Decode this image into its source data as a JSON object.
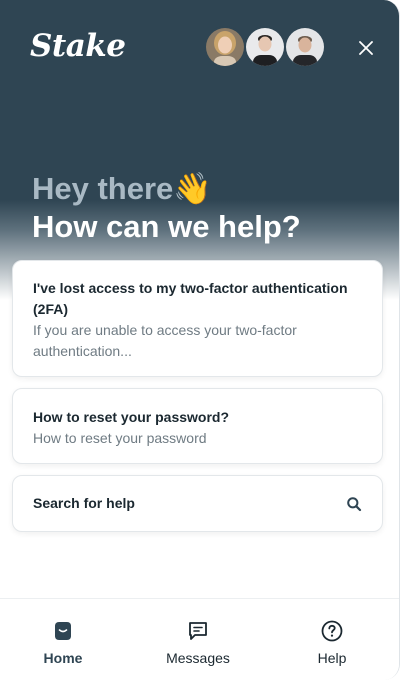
{
  "header": {
    "logo_text": "Stake",
    "avatars": [
      "team-member-1",
      "team-member-2",
      "team-member-3"
    ],
    "close_icon": "close-icon"
  },
  "hero": {
    "greeting": "Hey there",
    "greeting_emoji": "👋",
    "headline": "How can we help?"
  },
  "cards": [
    {
      "title": "I've lost access to my two-factor authentication (2FA)",
      "description": "If you are unable to access your two-factor authentication..."
    },
    {
      "title": "How to reset your password?",
      "description": "How to reset your password"
    }
  ],
  "search": {
    "label": "Search for help",
    "icon": "search-icon"
  },
  "nav": {
    "items": [
      {
        "label": "Home",
        "icon": "home-icon",
        "active": true
      },
      {
        "label": "Messages",
        "icon": "messages-icon",
        "active": false
      },
      {
        "label": "Help",
        "icon": "help-icon",
        "active": false
      }
    ]
  },
  "colors": {
    "brand_dark": "#2f4553",
    "greeting_muted": "#a9b9c4",
    "wave_emoji": "#f2b632",
    "text_primary": "#1b2830",
    "text_secondary": "#6f7b83"
  }
}
